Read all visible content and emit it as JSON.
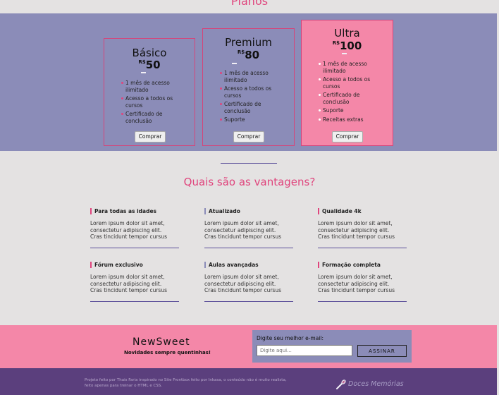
{
  "plans_section": {
    "title": "Planos",
    "cards": [
      {
        "name": "Básico",
        "currency": "R$",
        "price": "50",
        "button": "Comprar",
        "features": [
          "1 mês de acesso ilimitado",
          "Acesso a todos os cursos",
          "Certificado de conclusão"
        ]
      },
      {
        "name": "Premium",
        "currency": "R$",
        "price": "80",
        "button": "Comprar",
        "features": [
          "1 mês de acesso ilimitado",
          "Acesso a todos os cursos",
          "Certificado de conclusão",
          "Suporte"
        ]
      },
      {
        "name": "Ultra",
        "currency": "R$",
        "price": "100",
        "button": "Comprar",
        "features": [
          "1 mês de acesso ilimitado",
          "Acesso a todos os cursos",
          "Certificado de conclusão",
          "Suporte",
          "Receitas extras"
        ]
      }
    ]
  },
  "advantages_section": {
    "title": "Quais são as vantagens?",
    "items": [
      {
        "title": "Para todas as idades",
        "lines": [
          "Lorem ipsum dolor sit amet,",
          "consectetur adipiscing elit.",
          "Cras tincidunt tempor cursus"
        ]
      },
      {
        "title": "Atualizado",
        "lines": [
          "Lorem ipsum dolor sit amet,",
          "consectetur adipiscing elit.",
          "Cras tincidunt tempor cursus"
        ]
      },
      {
        "title": "Qualidade 4k",
        "lines": [
          "Lorem ipsum dolor sit amet,",
          "consectetur adipiscing elit.",
          "Cras tincidunt tempor cursus"
        ]
      },
      {
        "title": "Fórum exclusivo",
        "lines": [
          "Lorem ipsum dolor sit amet,",
          "consectetur adipiscing elit.",
          "Cras tincidunt tempor cursus"
        ]
      },
      {
        "title": "Aulas avançadas",
        "lines": [
          "Lorem ipsum dolor sit amet,",
          "consectetur adipiscing elit.",
          "Cras tincidunt tempor cursus"
        ]
      },
      {
        "title": "Formação completa",
        "lines": [
          "Lorem ipsum dolor sit amet,",
          "consectetur adipiscing elit.",
          "Cras tincidunt tempor cursus"
        ]
      }
    ]
  },
  "newsletter": {
    "title": "NewSweet",
    "subtitle": "Novidades sempre quentinhas!",
    "label": "Digite seu melhor e-mail:",
    "placeholder": "Digite aqui...",
    "button": "ASSINAR"
  },
  "footer": {
    "line1": "Projeto feito por Thais Faria inspirado no Site Frontbox feito por Inkasa, o conteúdo não é muito realista,",
    "line2": "feito apenas para treinar o HTML e CSS.",
    "brand": "Doces Memórias",
    "logo_icon": "whisk-icon"
  },
  "colors": {
    "accent_pink": "#e0457d",
    "band_purple": "#8b8cb8",
    "ultra_pink": "#f487a8",
    "footer_purple": "#5b3f7d",
    "background": "#e4e2e2"
  }
}
